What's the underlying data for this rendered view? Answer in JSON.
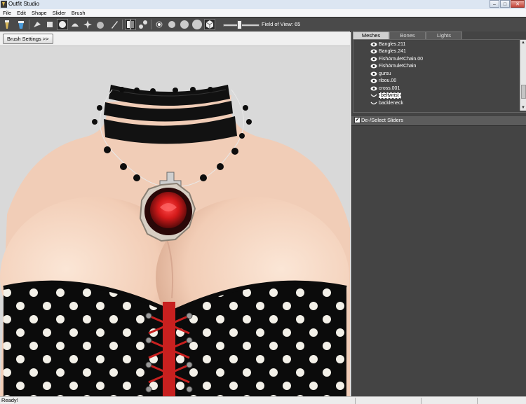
{
  "window": {
    "title": "Outfit Studio",
    "controls": [
      "–",
      "□",
      "✕"
    ]
  },
  "menu": [
    "File",
    "Edit",
    "Shape",
    "Slider",
    "Brush"
  ],
  "toolbar": {
    "fov_label": "Field of View: 65",
    "fov_value": 65
  },
  "brush_settings_label": "Brush Settings >>",
  "panel": {
    "tabs": [
      "Meshes",
      "Bones",
      "Lights"
    ],
    "active_tab": "Meshes",
    "meshes": [
      {
        "label": "Bangles.211",
        "visible": true
      },
      {
        "label": "Bangles.241",
        "visible": true
      },
      {
        "label": "FishAmuletChain.00",
        "visible": true
      },
      {
        "label": "FishAmuletChain",
        "visible": true
      },
      {
        "label": "gursu",
        "visible": true
      },
      {
        "label": "ribou.00",
        "visible": true
      },
      {
        "label": "cross.001",
        "visible": true
      },
      {
        "label": "beltwrist",
        "visible": false,
        "selected": true
      },
      {
        "label": "backleneck",
        "visible": false
      }
    ],
    "sliders_header": "De-/Select Sliders",
    "sliders_checked": true
  },
  "status": {
    "text": "Ready!"
  },
  "colors": {
    "toolbar": "#4a4a4a",
    "panel": "#444444",
    "viewport": "#d9d9d9",
    "corset_red": "#c8201f"
  }
}
